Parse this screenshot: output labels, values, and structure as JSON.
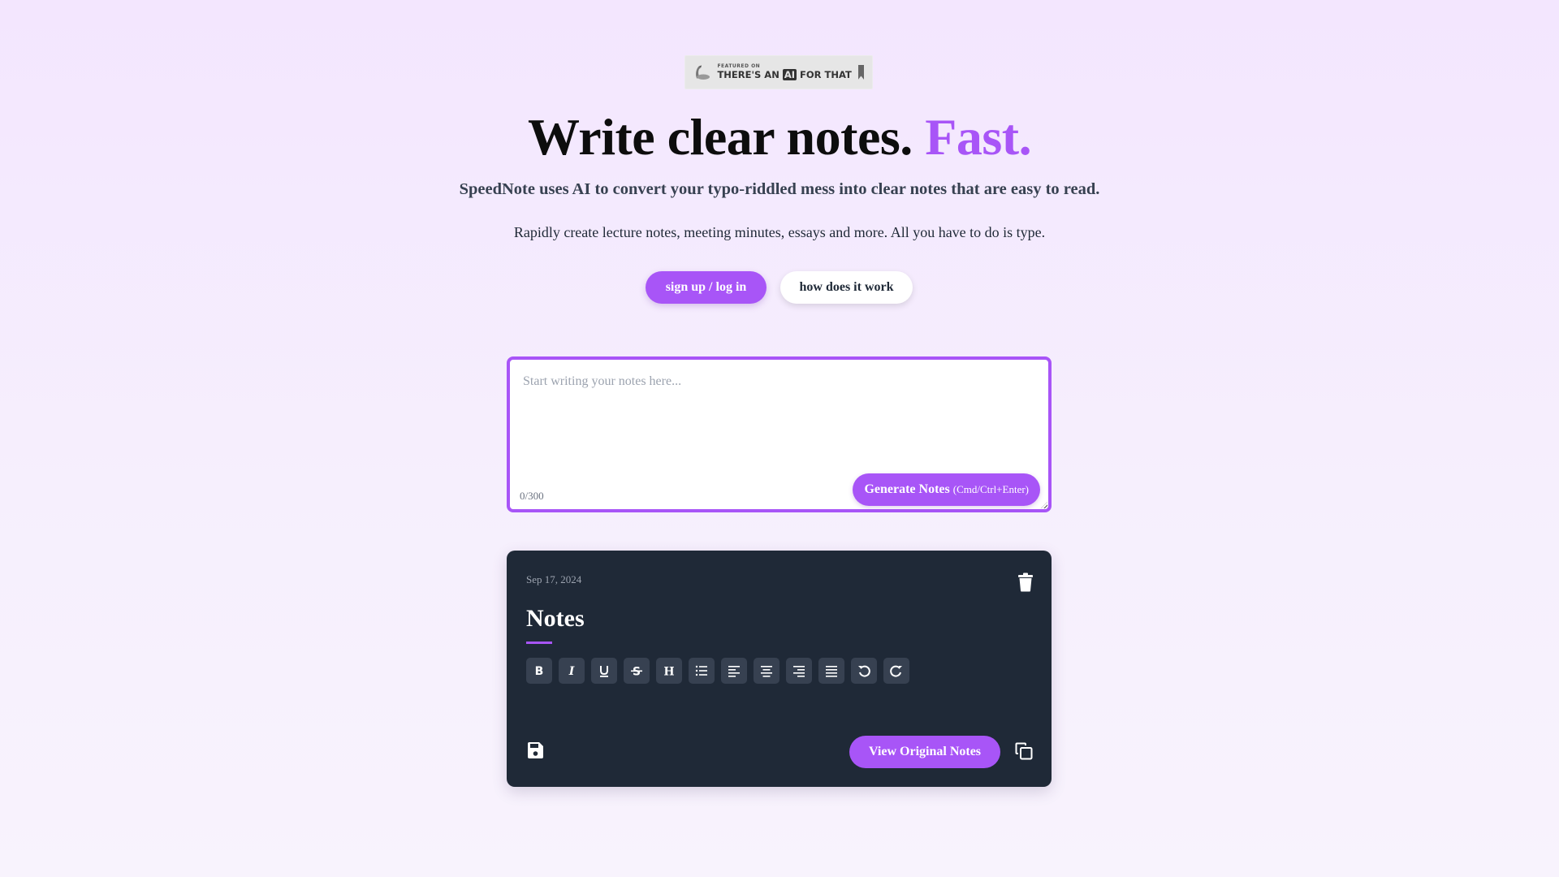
{
  "badge": {
    "small_text": "FEATURED ON",
    "text_before": "THERE'S AN ",
    "ai_text": "AI",
    "text_after": " FOR THAT",
    "icon": "bookmark-icon"
  },
  "hero": {
    "headline_main": "Write clear notes. ",
    "headline_accent": "Fast.",
    "subtitle": "SpeedNote uses AI to convert your typo-riddled mess into clear notes that are easy to read.",
    "description": "Rapidly create lecture notes, meeting minutes, essays and more. All you have to do is type."
  },
  "actions": {
    "primary_label": "sign up / log in",
    "secondary_label": "how does it work"
  },
  "editor": {
    "placeholder": "Start writing your notes here...",
    "value": "",
    "counter": "0/300",
    "generate_label": "Generate Notes",
    "generate_hint": "(Cmd/Ctrl+Enter)"
  },
  "note_card": {
    "date": "Sep 17, 2024",
    "title": "Notes",
    "toolbar": [
      {
        "name": "bold",
        "icon": "bold-icon"
      },
      {
        "name": "italic",
        "icon": "italic-icon"
      },
      {
        "name": "underline",
        "icon": "underline-icon"
      },
      {
        "name": "strikethrough",
        "icon": "strikethrough-icon"
      },
      {
        "name": "heading",
        "icon": "heading-icon"
      },
      {
        "name": "bullet-list",
        "icon": "list-icon"
      },
      {
        "name": "align-left",
        "icon": "align-left-icon"
      },
      {
        "name": "align-center",
        "icon": "align-center-icon"
      },
      {
        "name": "align-right",
        "icon": "align-right-icon"
      },
      {
        "name": "align-justify",
        "icon": "align-justify-icon"
      },
      {
        "name": "undo",
        "icon": "undo-icon"
      },
      {
        "name": "redo",
        "icon": "redo-icon"
      }
    ],
    "view_original_label": "View Original Notes"
  },
  "colors": {
    "accent": "#a855f7",
    "card_bg": "#1f2937",
    "tool_bg": "#374151"
  }
}
